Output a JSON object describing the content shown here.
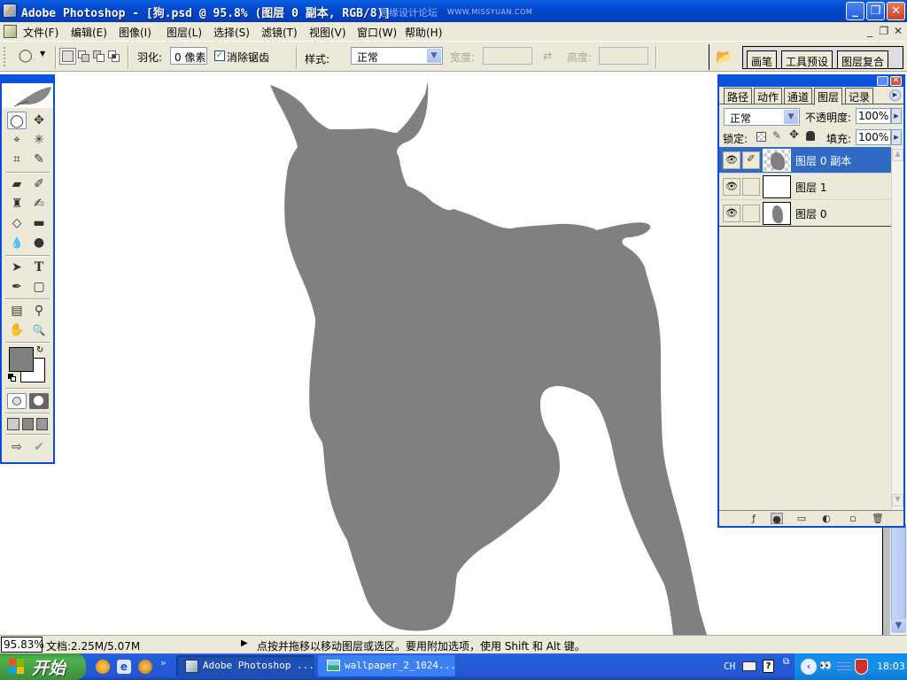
{
  "window": {
    "title": "Adobe Photoshop - [狗.psd @ 95.8% (图层 0 副本, RGB/8)]",
    "watermark": "思缘设计论坛",
    "watermark_url": "WWW.MISSYUAN.COM",
    "controls": {
      "minimize": "_",
      "restore": "❐",
      "close": "✕"
    }
  },
  "menubar": {
    "items": [
      {
        "label": "文件(F)"
      },
      {
        "label": "编辑(E)"
      },
      {
        "label": "图像(I)"
      },
      {
        "label": "图层(L)"
      },
      {
        "label": "选择(S)"
      },
      {
        "label": "滤镜(T)"
      },
      {
        "label": "视图(V)"
      },
      {
        "label": "窗口(W)"
      },
      {
        "label": "帮助(H)"
      }
    ],
    "doc_controls": {
      "minimize": "_",
      "restore": "❐",
      "close": "✕"
    }
  },
  "options": {
    "tool_preset_icon": "◯",
    "feather_label": "羽化:",
    "feather_value": "0 像素",
    "antialias_label": "消除锯齿",
    "antialias_checked": true,
    "style_label": "样式:",
    "style_value": "正常",
    "width_label": "宽度:",
    "width_value": "",
    "swap_icon": "⇄",
    "height_label": "高度:",
    "height_value": "",
    "palette_tabs": [
      "画笔",
      "工具预设",
      "图层复合"
    ]
  },
  "toolbox": {
    "tools": [
      {
        "name": "elliptical-marquee",
        "glyph": "◯"
      },
      {
        "name": "move",
        "glyph": "✥"
      },
      {
        "name": "polygonal-lasso",
        "glyph": "⌖"
      },
      {
        "name": "magic-wand",
        "glyph": "✳"
      },
      {
        "name": "crop",
        "glyph": "⌗"
      },
      {
        "name": "slice",
        "glyph": "✎"
      },
      {
        "name": "healing-brush",
        "glyph": "▰"
      },
      {
        "name": "brush",
        "glyph": "✐"
      },
      {
        "name": "clone-stamp",
        "glyph": "♜"
      },
      {
        "name": "history-brush",
        "glyph": "✍"
      },
      {
        "name": "eraser",
        "glyph": "◇"
      },
      {
        "name": "gradient",
        "glyph": "▬"
      },
      {
        "name": "blur",
        "glyph": "💧"
      },
      {
        "name": "dodge",
        "glyph": "●"
      },
      {
        "name": "path-selection",
        "glyph": "➤"
      },
      {
        "name": "type",
        "glyph": "T"
      },
      {
        "name": "pen",
        "glyph": "✒"
      },
      {
        "name": "rectangle-shape",
        "glyph": "▢"
      },
      {
        "name": "notes",
        "glyph": "▤"
      },
      {
        "name": "eyedropper",
        "glyph": "⚲"
      },
      {
        "name": "hand",
        "glyph": "✋"
      },
      {
        "name": "zoom",
        "glyph": "🔍"
      }
    ],
    "foreground_color": "#808080",
    "background_color": "#ffffff"
  },
  "layers_panel": {
    "tabs": [
      "路径",
      "动作",
      "通道",
      "图层",
      "记录"
    ],
    "active_tab": "图层",
    "blend_mode": "正常",
    "opacity_label": "不透明度:",
    "opacity_value": "100%",
    "lock_label": "锁定:",
    "fill_label": "填充:",
    "fill_value": "100%",
    "layers": [
      {
        "name": "图层 0 副本",
        "visible": true,
        "active": true,
        "linked_brush": true
      },
      {
        "name": "图层 1",
        "visible": true,
        "active": false,
        "linked_brush": false
      },
      {
        "name": "图层 0",
        "visible": true,
        "active": false,
        "linked_brush": false
      }
    ]
  },
  "statusbar": {
    "zoom": "95.83%",
    "doc_info": "文档:2.25M/5.07M",
    "hint": "点按并拖移以移动图层或选区。要用附加选项，使用 Shift 和 Alt 键。"
  },
  "taskbar": {
    "start_label": "开始",
    "more": "»",
    "tasks": [
      {
        "label": "Adobe Photoshop ...",
        "active": true
      },
      {
        "label": "wallpaper_2_1024...",
        "active": false
      }
    ],
    "tray": {
      "lang": "CH",
      "clock": "18:03"
    }
  },
  "colors": {
    "silhouette": "#808080",
    "xp_blue": "#0a4cd4",
    "selection_blue": "#316ac5"
  }
}
